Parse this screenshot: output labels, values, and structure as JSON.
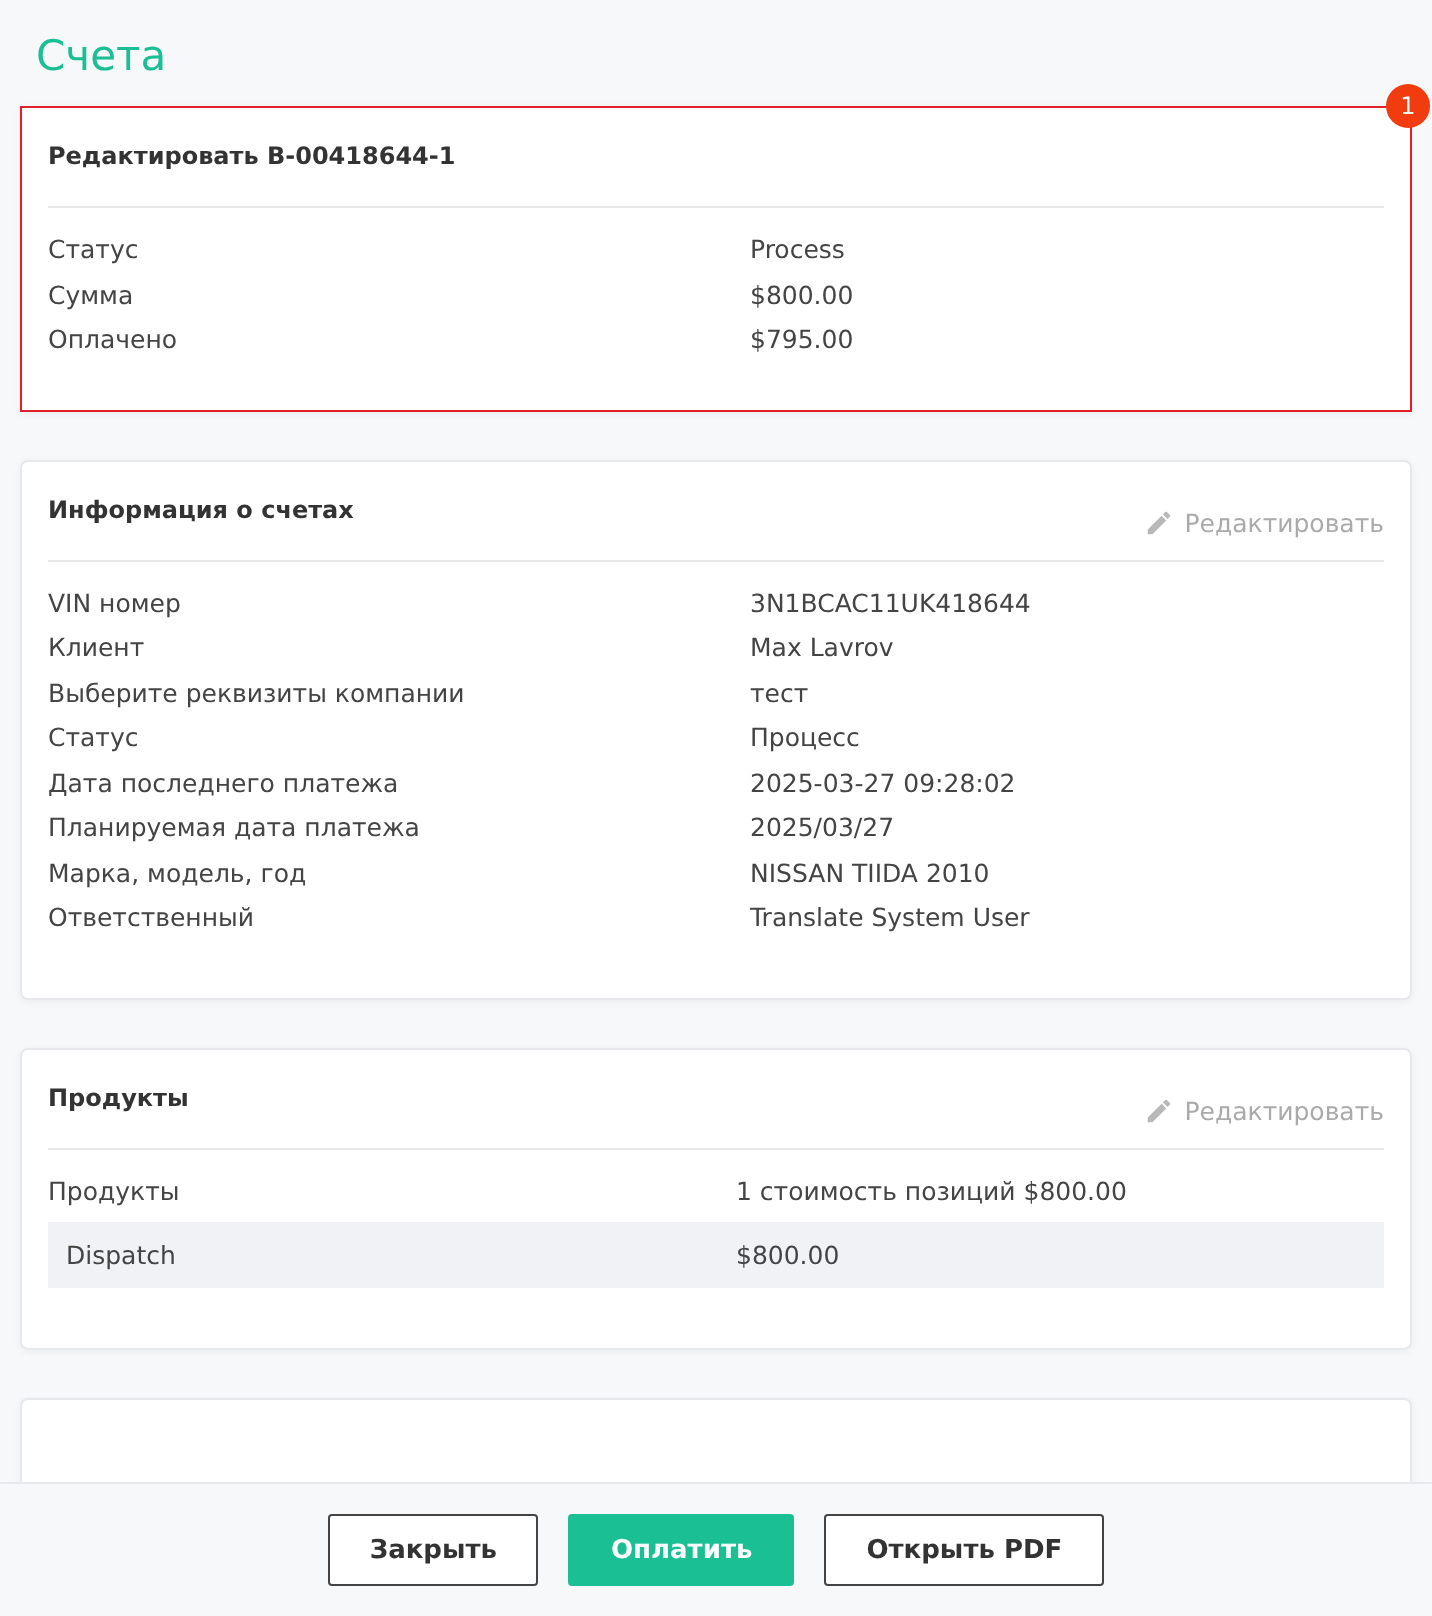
{
  "page": {
    "title": "Счета"
  },
  "sections": [
    {
      "title": "Редактировать B-00418644-1",
      "highlighted": true,
      "badge": "1",
      "rows": [
        {
          "label": "Статус",
          "value": "Process"
        },
        {
          "label": "Сумма",
          "value": "$800.00"
        },
        {
          "label": "Оплачено",
          "value": "$795.00"
        }
      ]
    },
    {
      "title": "Информация о счетах",
      "highlighted": false,
      "edit_link": "Редактировать",
      "rows": [
        {
          "label": "VIN номер",
          "value": "3N1BCAC11UK418644"
        },
        {
          "label": "Клиент",
          "value": "Max Lavrov"
        },
        {
          "label": "Выберите реквизиты компании",
          "value": "тест"
        },
        {
          "label": "Статус",
          "value": "Процесс"
        },
        {
          "label": "Дата последнего платежа",
          "value": "2025-03-27 09:28:02"
        },
        {
          "label": "Планируемая дата платежа",
          "value": "2025/03/27"
        },
        {
          "label": "Марка, модель, год",
          "value": "NISSAN TIIDA 2010"
        },
        {
          "label": "Ответственный",
          "value": "Translate System User"
        }
      ]
    },
    {
      "title": "Продукты",
      "highlighted": false,
      "edit_link": "Редактировать",
      "rows": [
        {
          "label": "Продукты",
          "value": "1 стоимость позиций $800.00"
        }
      ],
      "items": [
        {
          "name": "Dispatch",
          "price": "$800.00"
        }
      ]
    }
  ],
  "more_below": true,
  "buttons": [
    {
      "label": "Закрыть",
      "kind": "outline"
    },
    {
      "label": "Оплатить",
      "kind": "primary"
    },
    {
      "label": "Открыть PDF",
      "kind": "outline"
    }
  ]
}
